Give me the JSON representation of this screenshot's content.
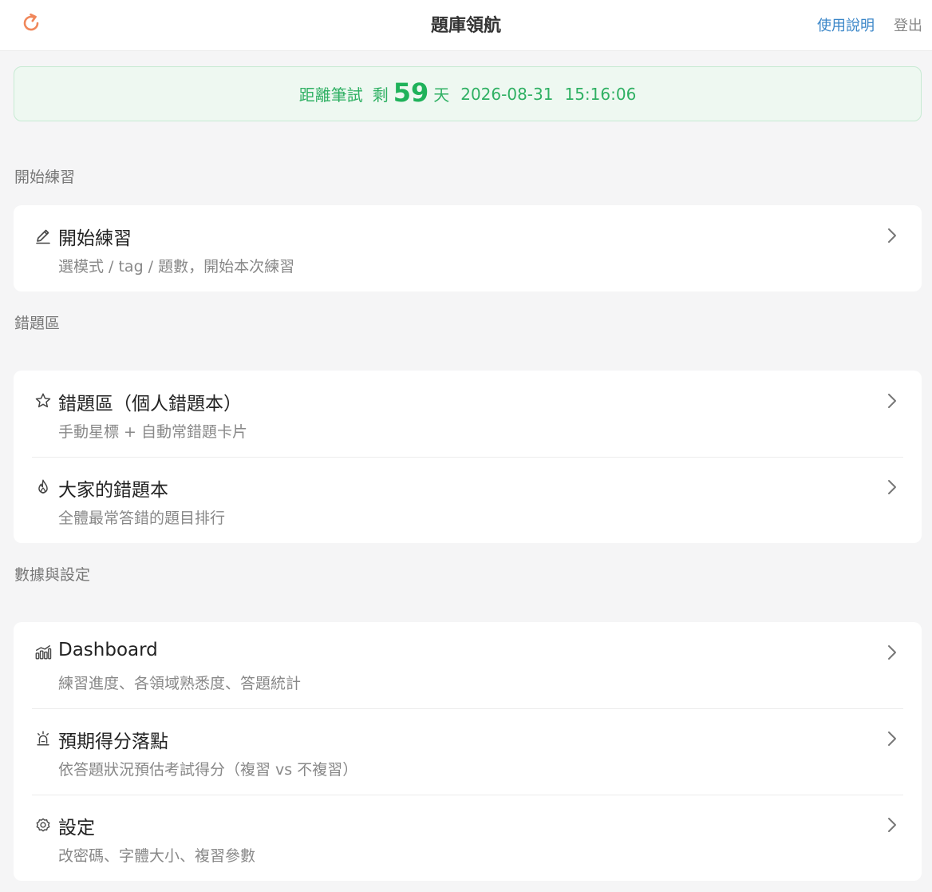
{
  "header": {
    "title": "題庫領航",
    "help_label": "使用說明",
    "logout_label": "登出"
  },
  "countdown": {
    "prefix": "距離筆試",
    "remain_label": "剩",
    "days": "59",
    "days_unit": "天",
    "date": "2026-08-31",
    "time": "15:16:06"
  },
  "sections": [
    {
      "label": "開始練習",
      "items": [
        {
          "title": "開始練習",
          "subtitle": "選模式 / tag / 題數，開始本次練習",
          "icon": "pencil-icon"
        }
      ]
    },
    {
      "label": "錯題區",
      "items": [
        {
          "title": "錯題區（個人錯題本）",
          "subtitle": "手動星標 + 自動常錯題卡片",
          "icon": "star-icon"
        },
        {
          "title": "大家的錯題本",
          "subtitle": "全體最常答錯的題目排行",
          "icon": "flame-icon"
        }
      ]
    },
    {
      "label": "數據與設定",
      "items": [
        {
          "title": "Dashboard",
          "subtitle": "練習進度、各領域熟悉度、答題統計",
          "icon": "chart-icon"
        },
        {
          "title": "預期得分落點",
          "subtitle": "依答題狀況預估考試得分（複習 vs 不複習）",
          "icon": "alarm-icon"
        },
        {
          "title": "設定",
          "subtitle": "改密碼、字體大小、複習參數",
          "icon": "gear-icon"
        }
      ]
    }
  ],
  "colors": {
    "accent_green": "#1fb25a",
    "link_blue": "#3a86c8",
    "refresh_orange": "#f0875a"
  }
}
